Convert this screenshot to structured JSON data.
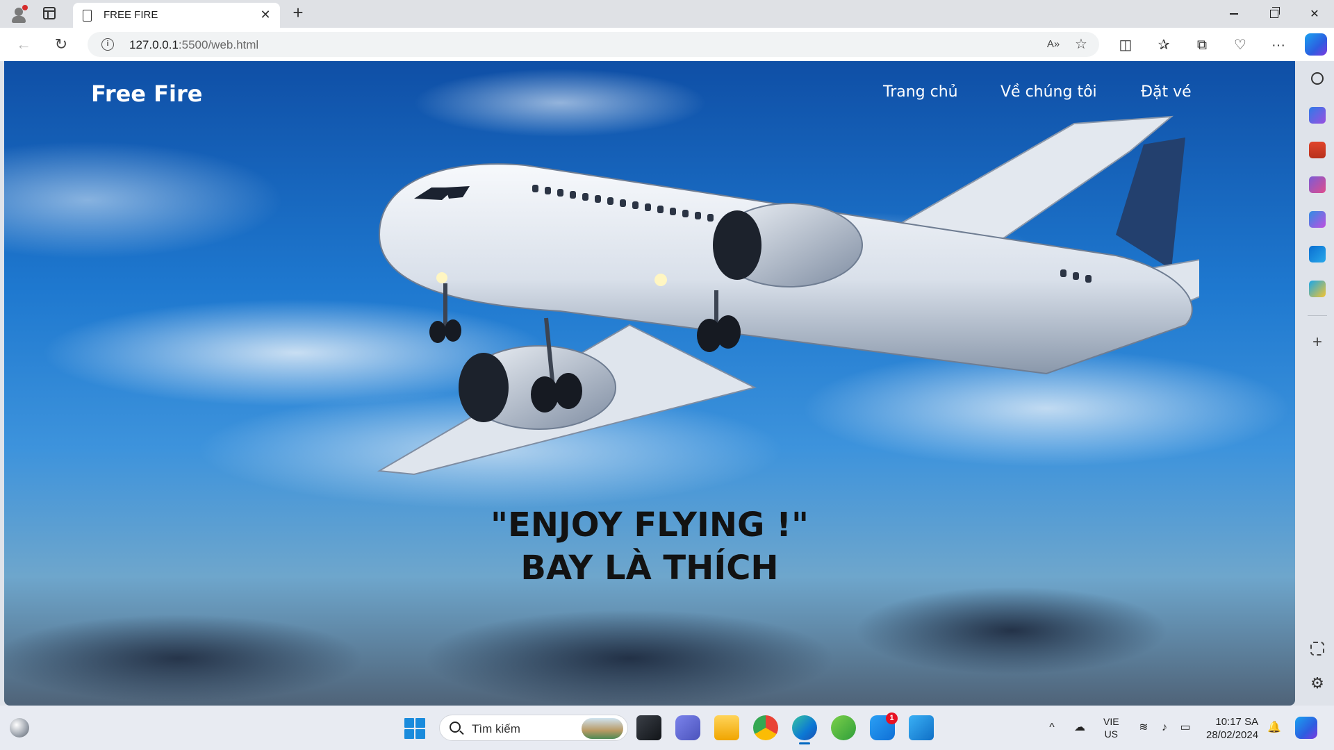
{
  "browser": {
    "tab_title": "FREE FIRE",
    "url_host": "127.0.0.1",
    "url_rest": ":5500/web.html"
  },
  "site": {
    "brand": "Free Fire",
    "nav": {
      "home": "Trang chủ",
      "about": "Về chúng tôi",
      "booking": "Đặt vé"
    },
    "hero": {
      "line1": "\"ENJOY FLYING !\"",
      "line2": "BAY LÀ THÍCH"
    }
  },
  "taskbar": {
    "search_placeholder": "Tìm kiếm",
    "zalo_badge": "1",
    "language": "VIE",
    "region": "US",
    "time": "10:17 SA",
    "date": "28/02/2024"
  },
  "colors": {
    "accent": "#0067c0",
    "sky": "#1e78cf",
    "hero_text": "#121212"
  }
}
